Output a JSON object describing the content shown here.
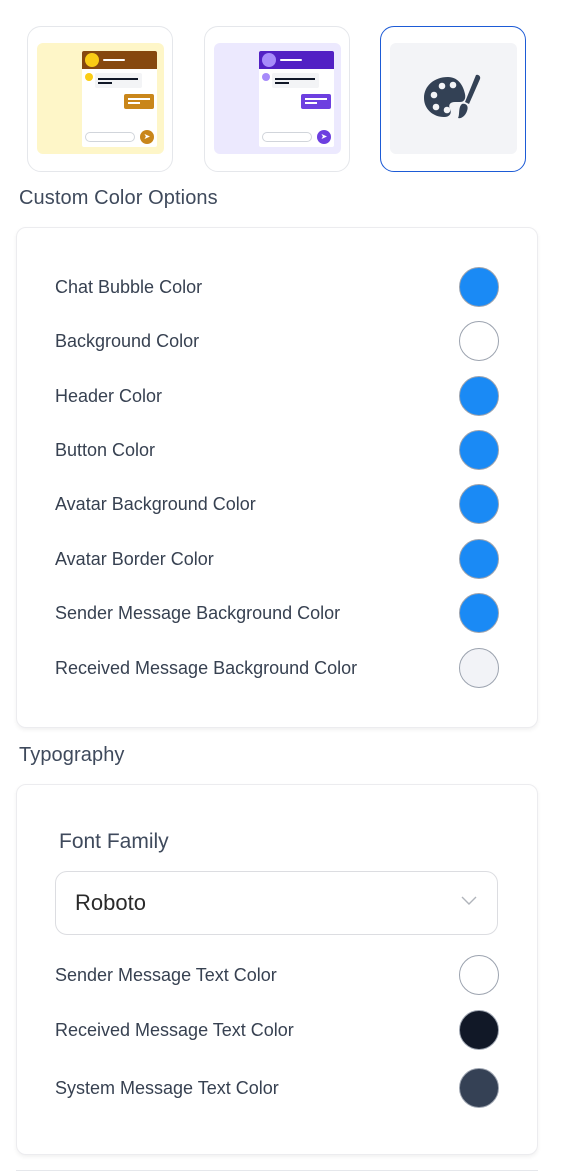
{
  "theme_presets": [
    {
      "name": "amber",
      "selected": false,
      "colors": {
        "background": "#fef6c8",
        "header": "#86480f",
        "avatar": "#facc15",
        "sent": "#c9861a",
        "send_button": "#c9861a"
      }
    },
    {
      "name": "purple",
      "selected": false,
      "colors": {
        "background": "#ece9fe",
        "header": "#5220c4",
        "avatar": "#a78bfa",
        "sent": "#6d3fe0",
        "send_button": "#6d3fe0"
      }
    },
    {
      "name": "custom",
      "selected": true,
      "icon": "palette-icon",
      "colors": {
        "background": "#f3f4f7",
        "icon": "#334155",
        "border": "#1d5bd6"
      }
    }
  ],
  "custom_colors": {
    "title": "Custom Color Options",
    "items": [
      {
        "label": "Chat Bubble Color",
        "color": "#1a8af5"
      },
      {
        "label": "Background Color",
        "color": "#ffffff"
      },
      {
        "label": "Header Color",
        "color": "#1a8af5"
      },
      {
        "label": "Button Color",
        "color": "#1a8af5"
      },
      {
        "label": "Avatar Background Color",
        "color": "#1a8af5"
      },
      {
        "label": "Avatar Border Color",
        "color": "#1a8af5"
      },
      {
        "label": "Sender Message Background Color",
        "color": "#1a8af5"
      },
      {
        "label": "Received Message Background Color",
        "color": "#f2f3f7"
      }
    ]
  },
  "typography": {
    "title": "Typography",
    "font_family_label": "Font Family",
    "font_family_value": "Roboto",
    "items": [
      {
        "label": "Sender Message Text Color",
        "color": "#ffffff"
      },
      {
        "label": "Received Message Text Color",
        "color": "#111827"
      },
      {
        "label": "System Message Text Color",
        "color": "#354155"
      }
    ]
  }
}
